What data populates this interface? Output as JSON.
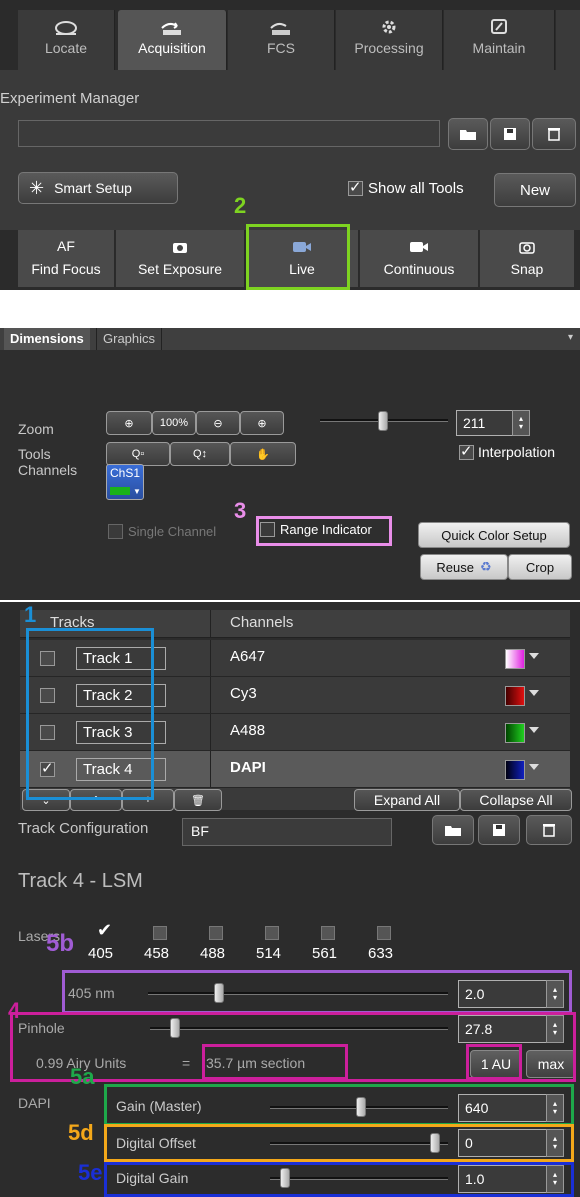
{
  "tabs": [
    {
      "label": "Locate",
      "icon": "locate-icon"
    },
    {
      "label": "Acquisition",
      "icon": "acquisition-icon"
    },
    {
      "label": "FCS",
      "icon": "fcs-icon"
    },
    {
      "label": "Processing",
      "icon": "gear-icon"
    },
    {
      "label": "Maintain",
      "icon": "wrench-icon"
    }
  ],
  "experiment": {
    "label": "Experiment Manager",
    "value": "",
    "smart_setup": "Smart Setup",
    "show_all_tools": "Show all Tools",
    "new_label": "New"
  },
  "actions": [
    {
      "line1": "AF",
      "line2": "Find Focus"
    },
    {
      "line1": "",
      "line2": "Set Exposure"
    },
    {
      "line1": "",
      "line2": "Live"
    },
    {
      "line1": "",
      "line2": "Continuous"
    },
    {
      "line1": "",
      "line2": "Snap"
    }
  ],
  "annotations": {
    "a2": "2",
    "a3": "3",
    "a1": "1",
    "a4": "4",
    "a5a": "5a",
    "a5b": "5b",
    "a5d": "5d",
    "a5e": "5e"
  },
  "annotation_colors": {
    "green": "#7ed321",
    "pink": "#e98ee9",
    "blue": "#1a8fd6",
    "purple": "#a05cd4",
    "magenta": "#cc1f9c",
    "darkgreen": "#1ea84a",
    "orange": "#f4a81a",
    "navy": "#1a2fd6"
  },
  "dimensions": {
    "tabs": [
      "Dimensions",
      "Graphics"
    ],
    "zoom_label": "Zoom",
    "zoom_100": "100%",
    "zoom_value": "211",
    "tools_label": "Tools",
    "interpolation": "Interpolation",
    "channels_label": "Channels",
    "channel_name": "ChS1",
    "single_channel": "Single Channel",
    "range_indicator": "Range Indicator",
    "quick_color": "Quick Color Setup",
    "reuse": "Reuse",
    "crop": "Crop"
  },
  "tracks": {
    "header_tracks": "Tracks",
    "header_channels": "Channels",
    "rows": [
      {
        "name": "Track 1",
        "channel": "A647",
        "color": "#e020e0",
        "checked": false
      },
      {
        "name": "Track 2",
        "channel": "Cy3",
        "color": "#b01010",
        "checked": false
      },
      {
        "name": "Track 3",
        "channel": "A488",
        "color": "#20b020",
        "checked": false
      },
      {
        "name": "Track 4",
        "channel": "DAPI",
        "color": "#1020b0",
        "checked": true
      }
    ],
    "expand_all": "Expand All",
    "collapse_all": "Collapse All",
    "config_label": "Track Configuration",
    "config_value": "BF"
  },
  "lsm": {
    "title": "Track 4 - LSM",
    "lasers_label": "Lasers",
    "lasers": [
      {
        "nm": "405",
        "on": true
      },
      {
        "nm": "458",
        "on": false
      },
      {
        "nm": "488",
        "on": false
      },
      {
        "nm": "514",
        "on": false
      },
      {
        "nm": "561",
        "on": false
      },
      {
        "nm": "633",
        "on": false
      }
    ],
    "laser_line": "405 nm",
    "laser_value": "2.0",
    "pinhole_label": "Pinhole",
    "pinhole_value": "27.8",
    "airy": "0.99 Airy Units",
    "equals": "=",
    "section": "35.7 µm section",
    "one_au": "1 AU",
    "max": "max",
    "channel": "DAPI",
    "gain_label": "Gain (Master)",
    "gain_value": "640",
    "offset_label": "Digital Offset",
    "offset_value": "0",
    "dgain_label": "Digital Gain",
    "dgain_value": "1.0"
  }
}
